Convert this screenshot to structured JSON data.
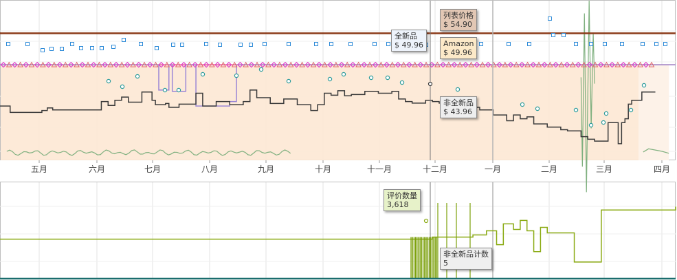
{
  "colors": {
    "list_price": "#8b3a18",
    "new": "#2e8bd8",
    "amazon": "#f19b2c",
    "used": "#3a3a3a",
    "buybox": "#e042c8",
    "sales_rank": "#7fb07f",
    "review_count": "#8aaa12",
    "used_count": "#1a6d6d",
    "area_fill": "#fde8d4",
    "grid": "#e3e3e3",
    "cursor": "#777777"
  },
  "chart_data": [
    {
      "type": "line",
      "title": "",
      "x_ticks": [
        "五月",
        "六月",
        "七月",
        "八月",
        "九月",
        "十月",
        "十一月",
        "十二月",
        "一月",
        "二月",
        "三月",
        "四月"
      ],
      "y_range": [
        35,
        60
      ],
      "series": [
        {
          "name": "列表价格",
          "points": [
            [
              0,
              54.9
            ],
            [
              1,
              54.9
            ]
          ]
        },
        {
          "name": "全新品",
          "points": [
            [
              0,
              49.96
            ],
            [
              0.22,
              49.96
            ],
            [
              0.235,
              46.0
            ],
            [
              0.25,
              49.96
            ],
            [
              0.255,
              45.8
            ],
            [
              0.27,
              45.8
            ],
            [
              0.275,
              49.96
            ],
            [
              0.29,
              43.5
            ],
            [
              0.33,
              43.5
            ],
            [
              0.34,
              44.2
            ],
            [
              0.35,
              49.96
            ],
            [
              1,
              49.96
            ]
          ]
        },
        {
          "name": "Amazon",
          "points": [
            [
              0,
              49.96
            ],
            [
              1,
              49.96
            ]
          ]
        },
        {
          "name": "非全新品",
          "points": [
            [
              0,
              43.5
            ],
            [
              0.013,
              43.5
            ],
            [
              0.015,
              42.5
            ],
            [
              0.035,
              42.5
            ],
            [
              0.062,
              42.8
            ],
            [
              0.07,
              43.2
            ],
            [
              0.078,
              42.9
            ],
            [
              0.15,
              44.2
            ],
            [
              0.16,
              43.6
            ],
            [
              0.17,
              44.4
            ],
            [
              0.18,
              44.9
            ],
            [
              0.19,
              44.1
            ],
            [
              0.2,
              44.1
            ],
            [
              0.21,
              45.7
            ],
            [
              0.22,
              45.7
            ],
            [
              0.225,
              44.4
            ],
            [
              0.23,
              43.7
            ],
            [
              0.24,
              43.7
            ],
            [
              0.245,
              43.9
            ],
            [
              0.25,
              43.3
            ],
            [
              0.255,
              43.3
            ],
            [
              0.265,
              43.8
            ],
            [
              0.275,
              43.8
            ],
            [
              0.29,
              45.5
            ],
            [
              0.3,
              43.5
            ],
            [
              0.31,
              43.5
            ],
            [
              0.32,
              44.2
            ],
            [
              0.33,
              44.2
            ],
            [
              0.34,
              43.7
            ],
            [
              0.35,
              43.7
            ],
            [
              0.36,
              44.2
            ],
            [
              0.37,
              46.0
            ],
            [
              0.38,
              44.8
            ],
            [
              0.39,
              44.8
            ],
            [
              0.4,
              43.9
            ],
            [
              0.41,
              43.9
            ],
            [
              0.42,
              44.6
            ],
            [
              0.43,
              44.6
            ],
            [
              0.44,
              43.7
            ],
            [
              0.45,
              43.7
            ],
            [
              0.46,
              42.8
            ],
            [
              0.47,
              43.7
            ],
            [
              0.48,
              45.5
            ],
            [
              0.49,
              45.2
            ],
            [
              0.5,
              45.9
            ],
            [
              0.51,
              45.1
            ],
            [
              0.52,
              45.3
            ],
            [
              0.53,
              45.3
            ],
            [
              0.54,
              45.8
            ],
            [
              0.55,
              45.8
            ],
            [
              0.56,
              45.5
            ],
            [
              0.57,
              45.5
            ],
            [
              0.58,
              45.8
            ],
            [
              0.59,
              44.6
            ],
            [
              0.6,
              44.2
            ],
            [
              0.61,
              43.96
            ],
            [
              0.62,
              43.96
            ],
            [
              0.63,
              44.4
            ],
            [
              0.64,
              44.2
            ],
            [
              0.65,
              43.96
            ],
            [
              0.66,
              43.96
            ],
            [
              0.67,
              44.2
            ],
            [
              0.68,
              43.7
            ],
            [
              0.69,
              43.7
            ],
            [
              0.7,
              43.3
            ],
            [
              0.71,
              42.9
            ],
            [
              0.72,
              42.9
            ],
            [
              0.73,
              42.1
            ],
            [
              0.74,
              42.1
            ],
            [
              0.75,
              41.2
            ],
            [
              0.76,
              42.1
            ],
            [
              0.77,
              41.5
            ],
            [
              0.78,
              41.8
            ],
            [
              0.79,
              40.7
            ],
            [
              0.8,
              40.7
            ],
            [
              0.81,
              40.2
            ],
            [
              0.82,
              40.2
            ],
            [
              0.83,
              39.8
            ],
            [
              0.84,
              39.6
            ],
            [
              0.85,
              39.6
            ],
            [
              0.86,
              38.7
            ],
            [
              0.87,
              38.3
            ],
            [
              0.88,
              38.0
            ],
            [
              0.89,
              38.0
            ],
            [
              0.9,
              40.9
            ],
            [
              0.91,
              40.9
            ],
            [
              0.915,
              37.6
            ],
            [
              0.92,
              40.9
            ],
            [
              0.925,
              41.5
            ],
            [
              0.93,
              43.8
            ],
            [
              0.935,
              44.4
            ],
            [
              0.94,
              44.4
            ],
            [
              0.95,
              45.7
            ],
            [
              0.97,
              45.7
            ]
          ]
        },
        {
          "name": "",
          "points": [
            [
              0,
              49.96
            ],
            [
              1,
              49.96
            ]
          ]
        }
      ]
    },
    {
      "type": "line",
      "title": "",
      "series": [
        {
          "name": "评价数量",
          "points": [
            [
              0,
              3618
            ],
            [
              0.55,
              3618
            ],
            [
              0.6,
              3618
            ],
            [
              0.64,
              3621
            ],
            [
              0.7,
              3624
            ],
            [
              0.72,
              3630
            ],
            [
              0.735,
              3610
            ],
            [
              0.745,
              3640
            ],
            [
              0.76,
              3632
            ],
            [
              0.77,
              3645
            ],
            [
              0.78,
              3630
            ],
            [
              0.79,
              3600
            ],
            [
              0.8,
              3635
            ],
            [
              0.81,
              3627
            ],
            [
              0.82,
              3627
            ],
            [
              0.85,
              3585
            ],
            [
              0.88,
              3585
            ],
            [
              0.89,
              3660
            ],
            [
              1,
              3665
            ]
          ]
        },
        {
          "name": "非全新品计数",
          "points": [
            [
              0,
              5
            ],
            [
              1,
              5
            ]
          ]
        }
      ]
    }
  ],
  "tooltips": {
    "list_price": {
      "label": "列表价格",
      "value": "$ 54.90"
    },
    "new": {
      "label": "全新品",
      "value": "$ 49.96"
    },
    "amazon": {
      "label": "Amazon",
      "value": "$ 49.96"
    },
    "used": {
      "label": "非全新品",
      "value": "$ 43.96"
    },
    "review_count": {
      "label": "评价数量",
      "value": "3,618"
    },
    "used_count": {
      "label": "非全新品计数",
      "value": "5"
    }
  }
}
